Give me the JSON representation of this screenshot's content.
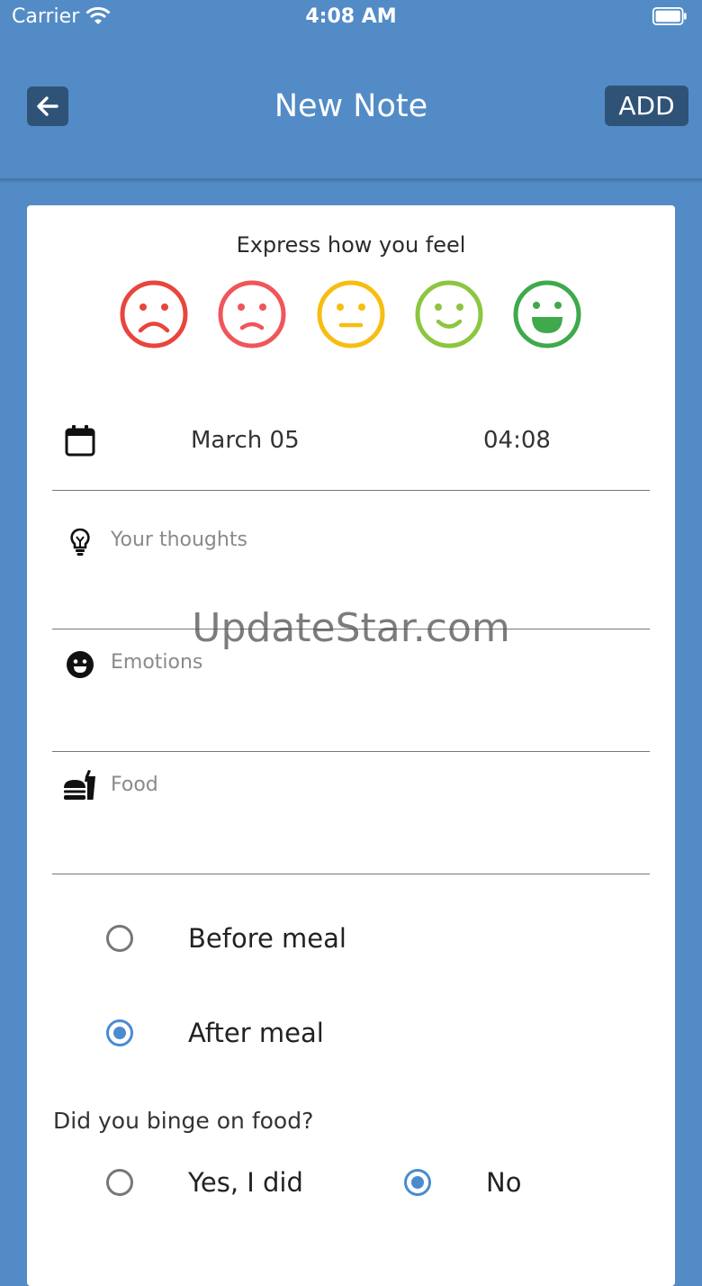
{
  "status_bar": {
    "carrier": "Carrier",
    "time": "4:08 AM"
  },
  "nav": {
    "title": "New Note",
    "add_label": "ADD"
  },
  "mood": {
    "prompt": "Express how you feel",
    "faces": [
      {
        "icon": "very-sad-face-icon",
        "color": "#e8453c"
      },
      {
        "icon": "sad-face-icon",
        "color": "#f0555a"
      },
      {
        "icon": "neutral-face-icon",
        "color": "#f7bd12"
      },
      {
        "icon": "happy-face-icon",
        "color": "#8cc63f"
      },
      {
        "icon": "very-happy-face-icon",
        "color": "#3fa94b"
      }
    ]
  },
  "date_row": {
    "icon": "calendar-icon",
    "date": "March 05",
    "time": "04:08"
  },
  "fields": {
    "thoughts_placeholder": "Your thoughts",
    "emotions_placeholder": "Emotions",
    "food_placeholder": "Food"
  },
  "meal_timing": {
    "options": [
      {
        "label": "Before meal",
        "selected": false
      },
      {
        "label": "After meal",
        "selected": true
      }
    ]
  },
  "binge": {
    "question": "Did you binge on food?",
    "options": [
      {
        "label": "Yes, I did",
        "selected": false
      },
      {
        "label": "No",
        "selected": true
      }
    ]
  },
  "watermark": "UpdateStar.com",
  "colors": {
    "background": "#538bc6",
    "button": "#2f5377",
    "radio_selected": "#4a8bd0"
  }
}
